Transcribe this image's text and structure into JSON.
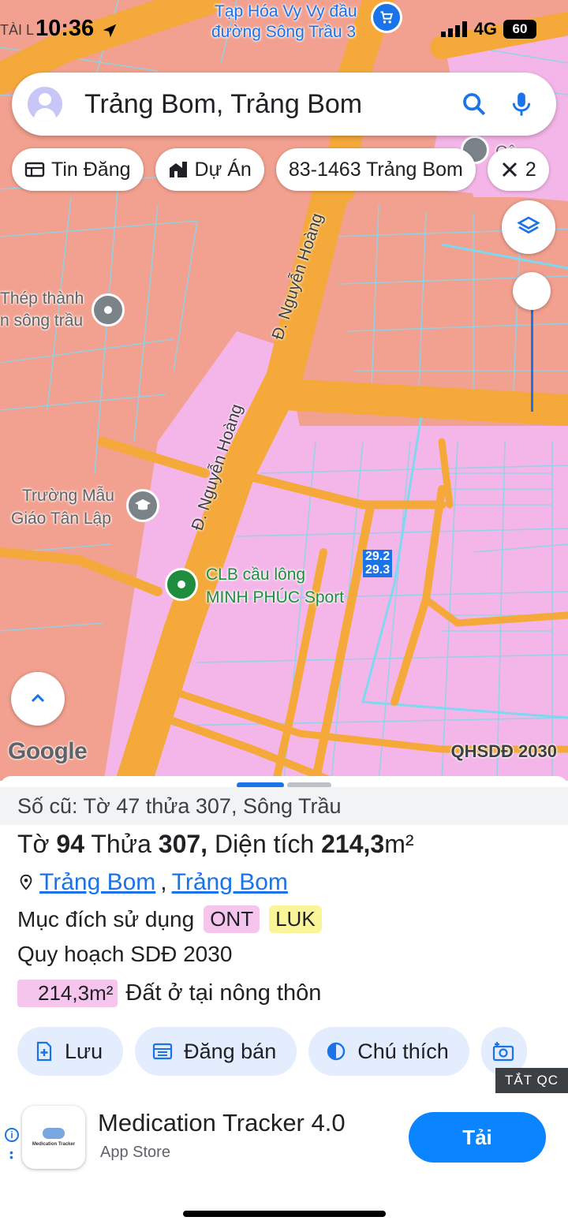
{
  "status_bar": {
    "carrier": "TÀI L",
    "time": "10:36",
    "network": "4G",
    "battery": "60"
  },
  "search": {
    "query": "Trảng Bom, Trảng Bom"
  },
  "chips": [
    {
      "label": "Tin Đăng",
      "icon": "news-icon"
    },
    {
      "label": "Dự Án",
      "icon": "building-icon"
    },
    {
      "label": "83-1463 Trảng Bom",
      "icon": ""
    },
    {
      "label": "2",
      "icon": "ruler-icon"
    }
  ],
  "map": {
    "pois": {
      "shop_line1": "Tạp Hóa Vy Vy đầu",
      "shop_line2": "đường Sông Trầu 3",
      "steel_line1": "Thép thành",
      "steel_line2": "n sông trầu",
      "school_line1": "Trường Mẫu",
      "school_line2": "Giáo Tân Lập",
      "club_line1": "CLB cầu lông",
      "club_line2": "MINH PHÚC Sport",
      "top_right": "Câ"
    },
    "roads": {
      "road1": "Đ. Nguyễn Hoàng",
      "road2": "Đ. Nguyễn Hoàng"
    },
    "parcel_tag_1": "29.2",
    "parcel_tag_2": "29.3",
    "google": "Google",
    "plan_label": "QHSDĐ 2030",
    "colors": {
      "residential": "#f4b6e8",
      "agricultural": "#f2a08f",
      "road": "#f4a93a",
      "boundary": "#8fd3e8"
    }
  },
  "sheet": {
    "old_info": "Số cũ: Tờ 47 thửa 307, Sông Trầu",
    "to_label": "Tờ",
    "to_value": "94",
    "thua_label": "Thửa",
    "thua_value": "307,",
    "dien_tich_label": "Diện tích",
    "dien_tich_value": "214,3",
    "dien_tich_unit": "m²",
    "location_1": "Trảng Bom",
    "location_sep": ",",
    "location_2": "Trảng Bom",
    "purpose_label": "Mục đích sử dụng",
    "purpose_tags": [
      "ONT",
      "LUK"
    ],
    "plan_title": "Quy hoạch SDĐ 2030",
    "plan_area": "214,3m²",
    "plan_desc": "Đất ở tại nông thôn",
    "actions": [
      "Lưu",
      "Đăng bán",
      "Chú thích"
    ],
    "ad_toggle": "TẮT QC"
  },
  "ad": {
    "title": "Medication Tracker 4.0",
    "subtitle": "App Store",
    "button": "Tải",
    "logo_text": "Medication Tracker"
  }
}
